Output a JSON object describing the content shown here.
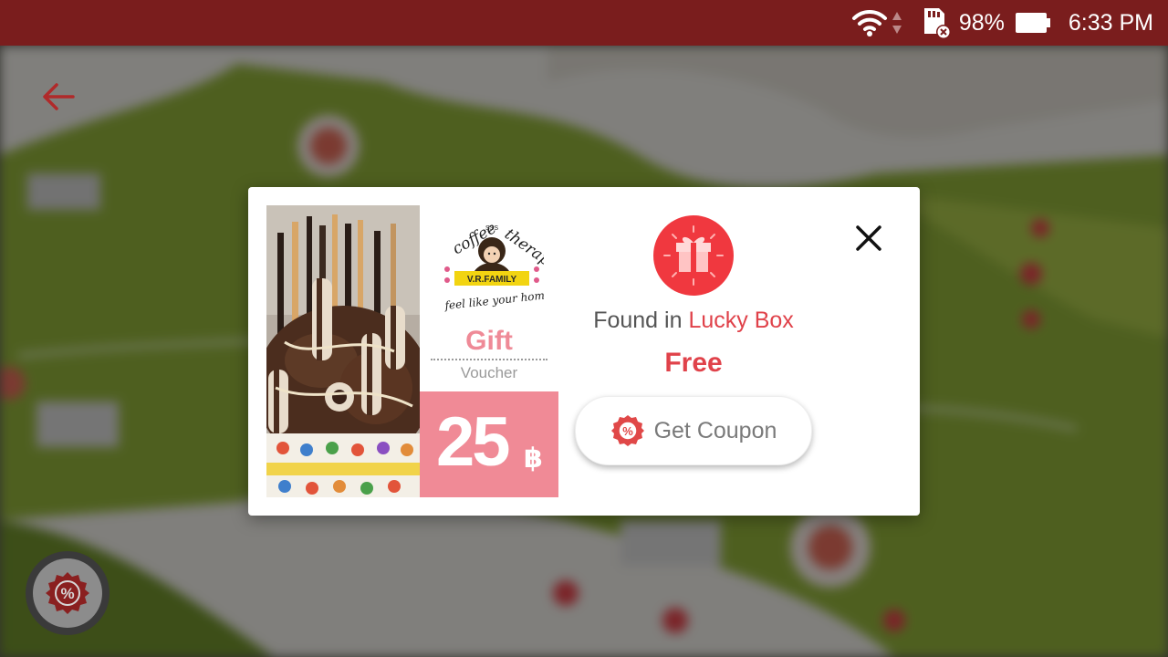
{
  "status_bar": {
    "battery_percent": "98%",
    "time": "6:33 PM",
    "icons": [
      "wifi-icon",
      "data-arrows-icon",
      "sd-card-icon",
      "battery-icon"
    ]
  },
  "nav": {
    "back_icon": "back-arrow-icon",
    "coupon_fab_icon": "coupon-badge-icon"
  },
  "modal": {
    "gift_title": "Gift",
    "gift_subtitle": "Voucher",
    "value_amount": "25",
    "value_currency": "฿",
    "found_prefix": "Found in",
    "found_source": "Lucky Box",
    "price_label": "Free",
    "cta_label": "Get Coupon",
    "cta_icon": "coupon-percent-icon",
    "badge_icon": "gift-box-icon",
    "close_icon": "close-icon",
    "shop_logo_text": {
      "word1": "coffee",
      "word2": "therapy",
      "small": "SSS",
      "banner": "V.R.FAMILY",
      "tagline": "feel like your home"
    }
  },
  "colors": {
    "status_bar": "#7a1d1d",
    "accent_red": "#e0424a",
    "voucher_pink": "#f08a96",
    "badge_red": "#f0383f"
  }
}
